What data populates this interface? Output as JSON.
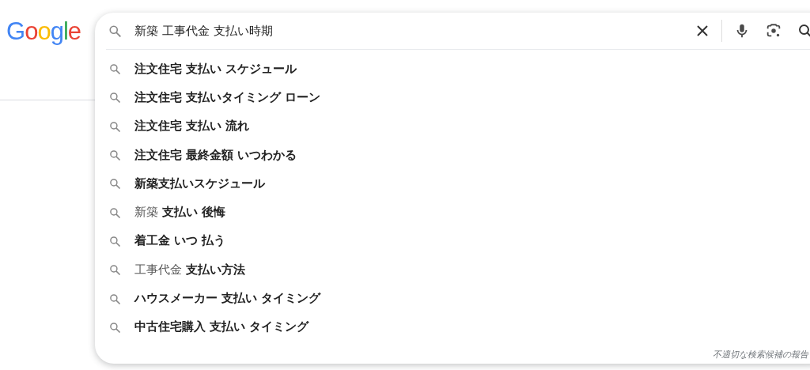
{
  "logo": "Google",
  "search": {
    "value": "新築 工事代金 支払い時期"
  },
  "suggestions": [
    {
      "text": "注文住宅 支払い スケジュール"
    },
    {
      "text": "注文住宅 支払いタイミング ローン"
    },
    {
      "text": "注文住宅 支払い 流れ"
    },
    {
      "text": "注文住宅 最終金額 いつわかる"
    },
    {
      "text": "新築支払いスケジュール"
    },
    {
      "prefix": "新築",
      "text": "支払い 後悔"
    },
    {
      "text": "着工金 いつ 払う"
    },
    {
      "prefix": "工事代金",
      "text": "支払い方法"
    },
    {
      "text": "ハウスメーカー 支払い タイミング"
    },
    {
      "text": "中古住宅購入 支払い タイミング"
    }
  ],
  "report_link": "不適切な検索候補の報告"
}
